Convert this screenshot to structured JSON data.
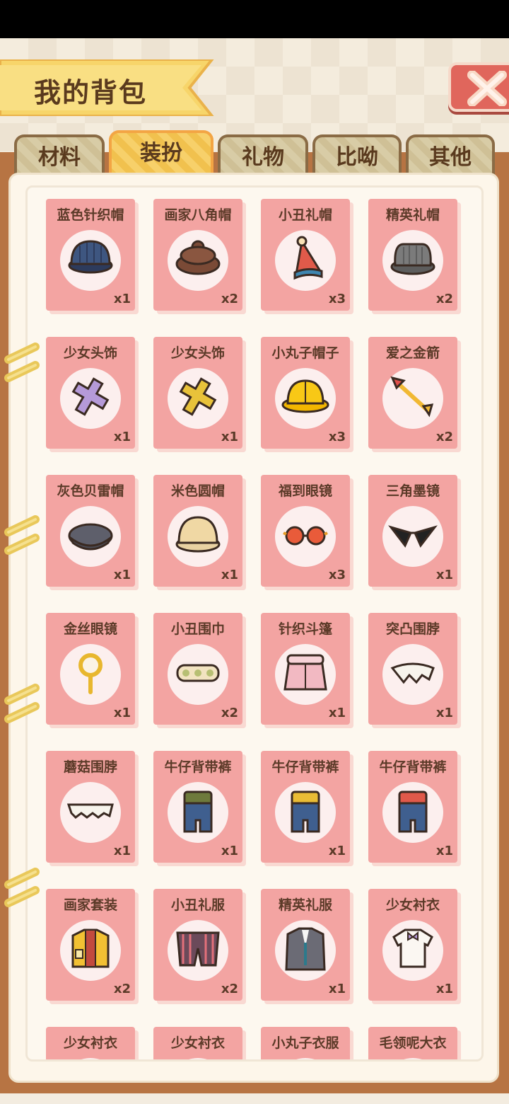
{
  "header": {
    "title": "我的背包"
  },
  "tabs": [
    {
      "label": "材料",
      "active": false
    },
    {
      "label": "装扮",
      "active": true
    },
    {
      "label": "礼物",
      "active": false
    },
    {
      "label": "比呦",
      "active": false
    },
    {
      "label": "其他",
      "active": false
    }
  ],
  "items": [
    {
      "name": "蓝色针织帽",
      "count": "x1",
      "icon": "blue-knit-hat-icon"
    },
    {
      "name": "画家八角帽",
      "count": "x2",
      "icon": "painter-beret-icon"
    },
    {
      "name": "小丑礼帽",
      "count": "x3",
      "icon": "clown-hat-icon"
    },
    {
      "name": "精英礼帽",
      "count": "x2",
      "icon": "elite-hat-icon"
    },
    {
      "name": "少女头饰",
      "count": "x1",
      "icon": "purple-cross-hairpin-icon"
    },
    {
      "name": "少女头饰",
      "count": "x1",
      "icon": "yellow-cross-hairpin-icon"
    },
    {
      "name": "小丸子帽子",
      "count": "x3",
      "icon": "yellow-school-hat-icon"
    },
    {
      "name": "爱之金箭",
      "count": "x2",
      "icon": "golden-arrow-icon"
    },
    {
      "name": "灰色贝雷帽",
      "count": "x1",
      "icon": "gray-beret-icon"
    },
    {
      "name": "米色圆帽",
      "count": "x1",
      "icon": "beige-round-hat-icon"
    },
    {
      "name": "福到眼镜",
      "count": "x3",
      "icon": "fortune-glasses-icon"
    },
    {
      "name": "三角墨镜",
      "count": "x1",
      "icon": "triangle-sunglasses-icon"
    },
    {
      "name": "金丝眼镜",
      "count": "x1",
      "icon": "monocle-icon"
    },
    {
      "name": "小丑围巾",
      "count": "x2",
      "icon": "clown-scarf-icon"
    },
    {
      "name": "针织斗篷",
      "count": "x1",
      "icon": "knit-cape-icon"
    },
    {
      "name": "突凸围脖",
      "count": "x1",
      "icon": "bumpy-collar-icon"
    },
    {
      "name": "蘑菇围脖",
      "count": "x1",
      "icon": "mushroom-collar-icon"
    },
    {
      "name": "牛仔背带裤",
      "count": "x1",
      "icon": "overalls-green-icon"
    },
    {
      "name": "牛仔背带裤",
      "count": "x1",
      "icon": "overalls-yellow-icon"
    },
    {
      "name": "牛仔背带裤",
      "count": "x1",
      "icon": "overalls-red-icon"
    },
    {
      "name": "画家套装",
      "count": "x2",
      "icon": "painter-suit-icon"
    },
    {
      "name": "小丑礼服",
      "count": "x2",
      "icon": "clown-shorts-icon"
    },
    {
      "name": "精英礼服",
      "count": "x1",
      "icon": "elite-suit-icon"
    },
    {
      "name": "少女衬衣",
      "count": "x1",
      "icon": "girl-shirt-icon"
    },
    {
      "name": "少女衬衣",
      "count": "",
      "icon": "girl-shirt-icon"
    },
    {
      "name": "少女衬衣",
      "count": "",
      "icon": "girl-shirt-icon"
    },
    {
      "name": "小丸子衣服",
      "count": "",
      "icon": "school-outfit-icon"
    },
    {
      "name": "毛领呢大衣",
      "count": "",
      "icon": "fur-coat-icon"
    }
  ]
}
